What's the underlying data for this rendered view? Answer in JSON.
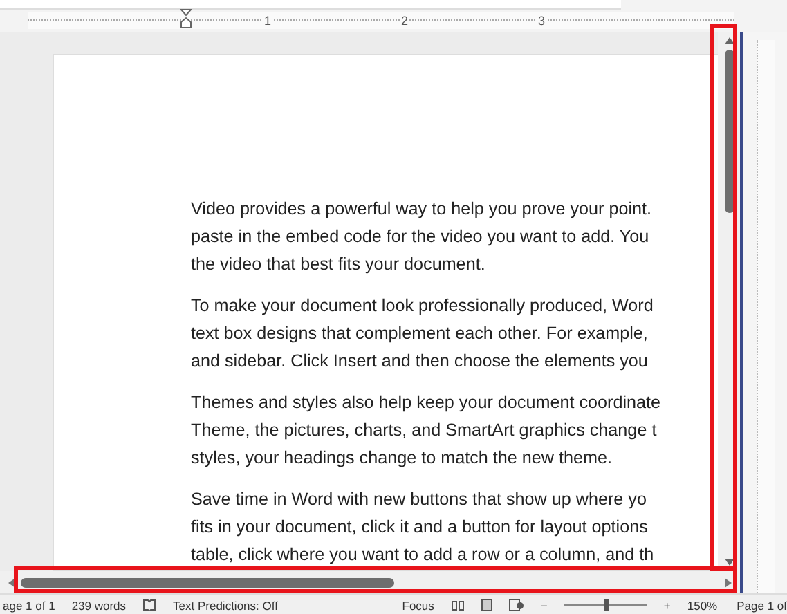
{
  "ruler": {
    "labels": [
      "1",
      "2",
      "3"
    ]
  },
  "document": {
    "paragraphs": [
      {
        "lines": [
          "Video provides a powerful way to help you prove your point.",
          "paste in the embed code for the video you want to add. You",
          "the video that best fits your document."
        ]
      },
      {
        "lines": [
          "To make your document look professionally produced, Word",
          "text box designs that complement each other. For example,",
          "and sidebar. Click Insert and then choose the elements you"
        ]
      },
      {
        "lines": [
          "Themes and styles also help keep your document coordinate",
          "Theme, the pictures, charts, and SmartArt graphics change t",
          "styles, your headings change to match the new theme."
        ]
      },
      {
        "lines": [
          "Save time in Word with new buttons that show up where yo",
          "fits in your document, click it and a button for layout options",
          "table, click where you want to add a row or a column, and th"
        ]
      }
    ]
  },
  "status_bar": {
    "page": "age 1 of 1",
    "words": "239 words",
    "predictions": "Text Predictions: Off",
    "focus": "Focus",
    "zoom": {
      "minus": "−",
      "plus": "+",
      "level": 0.5,
      "reading": "150%"
    }
  },
  "side_window": {
    "status": "Page 1 of"
  }
}
